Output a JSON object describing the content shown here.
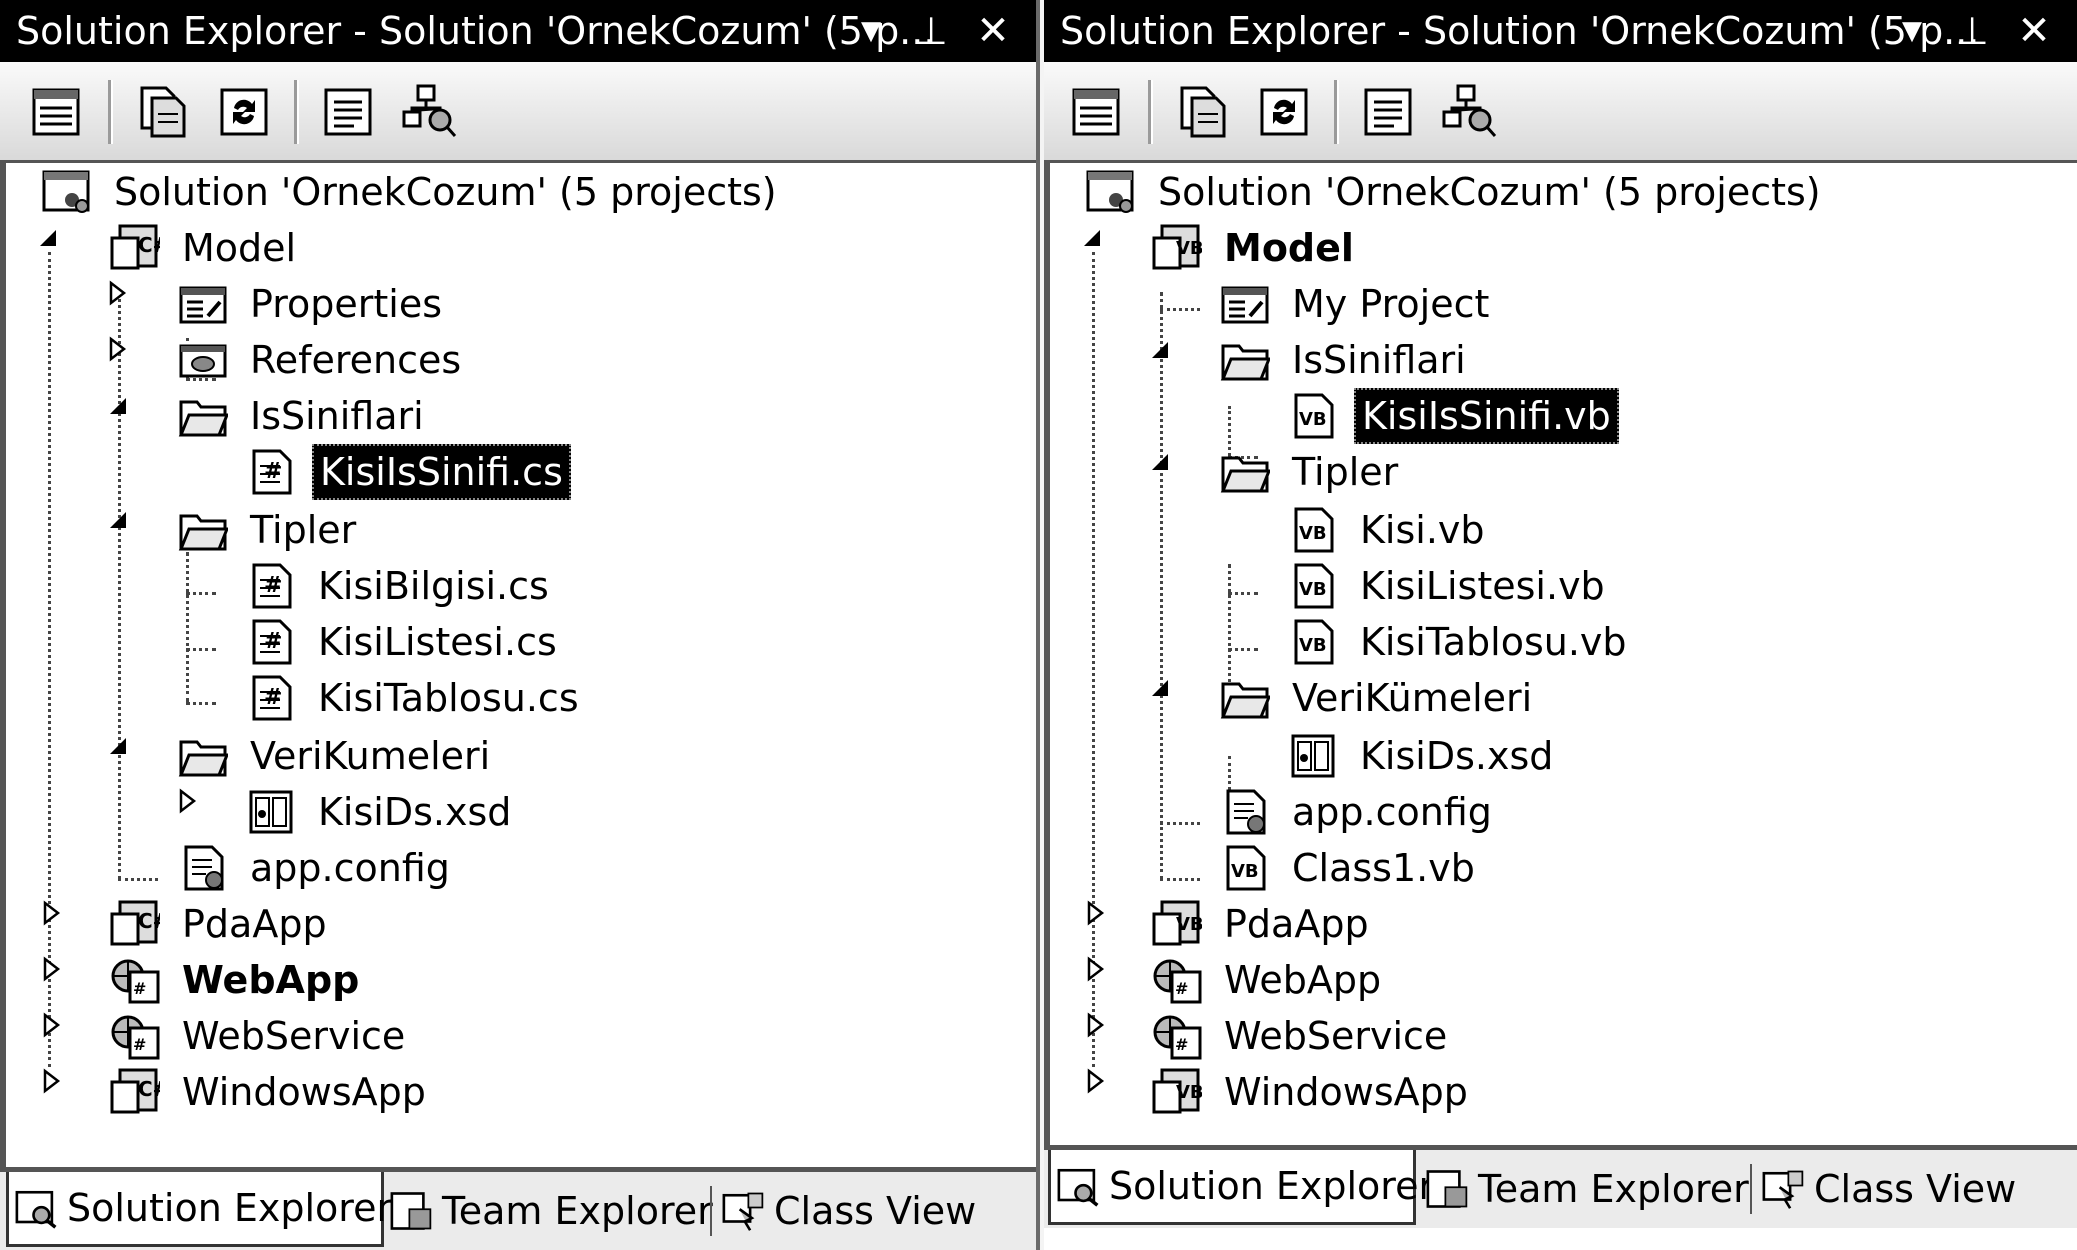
{
  "left": {
    "title": "Solution Explorer - Solution 'OrnekCozum' (5 p...",
    "items": [
      {
        "label": "Solution 'OrnekCozum' (5 projects)"
      },
      {
        "label": "Model"
      },
      {
        "label": "Properties"
      },
      {
        "label": "References"
      },
      {
        "label": "IsSiniflari"
      },
      {
        "label": "KisiIsSinifi.cs"
      },
      {
        "label": "Tipler"
      },
      {
        "label": "KisiBilgisi.cs"
      },
      {
        "label": "KisiListesi.cs"
      },
      {
        "label": "KisiTablosu.cs"
      },
      {
        "label": "VeriKumeleri"
      },
      {
        "label": "KisiDs.xsd"
      },
      {
        "label": "app.config"
      },
      {
        "label": "PdaApp"
      },
      {
        "label": "WebApp"
      },
      {
        "label": "WebService"
      },
      {
        "label": "WindowsApp"
      }
    ],
    "tabs": [
      "Solution Explorer",
      "Team Explorer",
      "Class View"
    ]
  },
  "right": {
    "title": "Solution Explorer - Solution 'OrnekCozum' (5 p...",
    "items": [
      {
        "label": "Solution 'OrnekCozum' (5 projects)"
      },
      {
        "label": "Model"
      },
      {
        "label": "My Project"
      },
      {
        "label": "IsSiniflari"
      },
      {
        "label": "KisiIsSinifi.vb"
      },
      {
        "label": "Tipler"
      },
      {
        "label": "Kisi.vb"
      },
      {
        "label": "KisiListesi.vb"
      },
      {
        "label": "KisiTablosu.vb"
      },
      {
        "label": "VeriKümeleri"
      },
      {
        "label": "KisiDs.xsd"
      },
      {
        "label": "app.config"
      },
      {
        "label": "Class1.vb"
      },
      {
        "label": "PdaApp"
      },
      {
        "label": "WebApp"
      },
      {
        "label": "WebService"
      },
      {
        "label": "WindowsApp"
      }
    ],
    "tabs": [
      "Solution Explorer",
      "Team Explorer",
      "Class View"
    ]
  },
  "icons": {
    "dropdown": "▼",
    "pin": "⊥",
    "close": "✕",
    "toolbar": [
      "properties-icon",
      "show-all-files-icon",
      "refresh-icon",
      "view-code-icon",
      "class-diagram-icon"
    ]
  },
  "colors": {
    "title_bg": "#000000",
    "selection_bg": "#000000",
    "selection_fg": "#ffffff"
  }
}
